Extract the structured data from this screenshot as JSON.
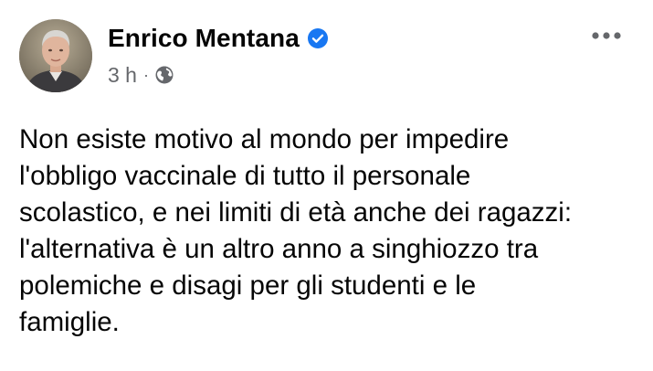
{
  "post": {
    "author": {
      "name": "Enrico Mentana",
      "verified": true,
      "avatar_icon": "profile-photo"
    },
    "meta": {
      "timestamp": "3 h",
      "separator": "·",
      "audience_icon": "globe-icon"
    },
    "more_icon": "more-horizontal-icon",
    "text": "Non esiste motivo al mondo per impedire\nl'obbligo vaccinale di tutto il personale\nscolastico, e nei limiti di età anche dei ragazzi:\nl'alternativa è un altro anno a singhiozzo tra\npolemiche e disagi per gli studenti e le\nfamiglie."
  },
  "colors": {
    "background": "#ffffff",
    "text_primary": "#050505",
    "text_secondary": "#65676b",
    "verified_badge": "#1877f2"
  }
}
